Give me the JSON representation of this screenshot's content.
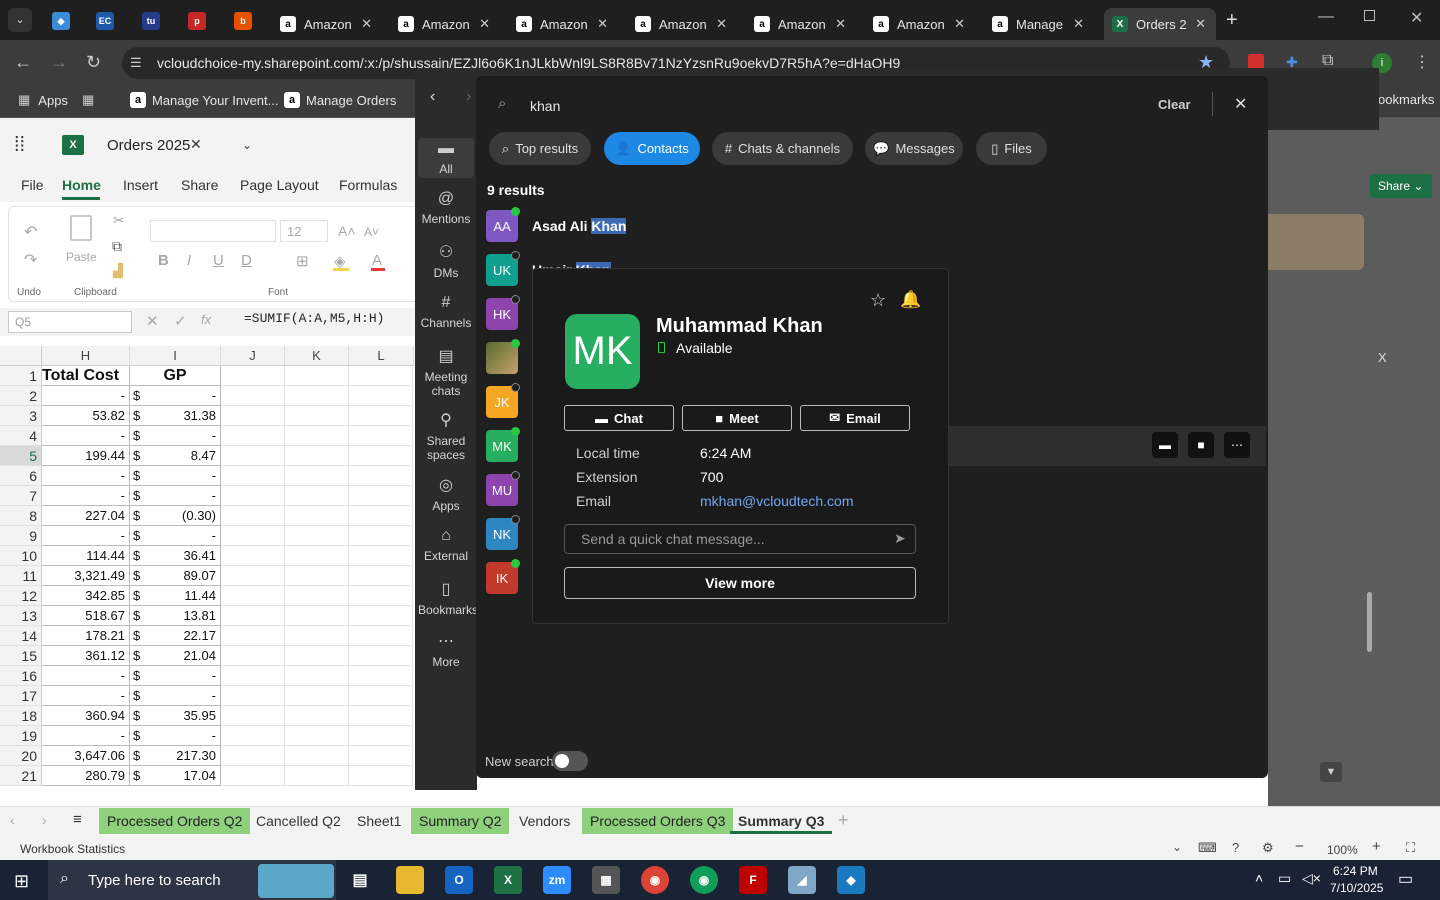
{
  "browser": {
    "tabs": [
      {
        "label": "Amazon",
        "favicon": "amazon-icon"
      },
      {
        "label": "Amazon",
        "favicon": "amazon-icon"
      },
      {
        "label": "Amazon",
        "favicon": "amazon-icon"
      },
      {
        "label": "Amazon",
        "favicon": "amazon-icon"
      },
      {
        "label": "Amazon",
        "favicon": "amazon-icon"
      },
      {
        "label": "Amazon",
        "favicon": "amazon-icon"
      },
      {
        "label": "Manage",
        "favicon": "amazon-icon"
      },
      {
        "label": "Orders 2",
        "favicon": "excel-icon"
      }
    ],
    "pinned": [
      "EC",
      "tu",
      "p",
      "b"
    ],
    "url": "vcloudchoice-my.sharepoint.com/:x:/p/shussain/EZJl6o6K1nJLkbWnl9LS8R8Bv71NzYzsnRu9oekvD7R5hA?e=dHaOH9",
    "bookmarks": {
      "apps": "Apps",
      "b1": "Manage Your Invent...",
      "b2": "Manage Orders",
      "overflow": "ookmarks"
    }
  },
  "excel": {
    "file_name": "Orders 2025",
    "ribbon_tabs": [
      "File",
      "Home",
      "Insert",
      "Share",
      "Page Layout",
      "Formulas"
    ],
    "active_tab": "Home",
    "undo_label": "Undo",
    "clipboard_label": "Clipboard",
    "paste_label": "Paste",
    "font_label": "Font",
    "font_size": "12",
    "share_label": "Share",
    "user_initials": "IK",
    "name_box": "Q5",
    "formula": "=SUMIF(A:A,M5,H:H)",
    "columns": [
      "H",
      "I",
      "J",
      "K",
      "L"
    ],
    "right_col": "X",
    "headers": {
      "H": "Total Cost",
      "I": "GP"
    },
    "rows": [
      {
        "n": "2",
        "h": "-",
        "c": "$",
        "i": "-"
      },
      {
        "n": "3",
        "h": "53.82",
        "c": "$",
        "i": "31.38"
      },
      {
        "n": "4",
        "h": "-",
        "c": "$",
        "i": "-"
      },
      {
        "n": "5",
        "h": "199.44",
        "c": "$",
        "i": "8.47"
      },
      {
        "n": "6",
        "h": "-",
        "c": "$",
        "i": "-"
      },
      {
        "n": "7",
        "h": "-",
        "c": "$",
        "i": "-"
      },
      {
        "n": "8",
        "h": "227.04",
        "c": "$",
        "i": "(0.30)"
      },
      {
        "n": "9",
        "h": "-",
        "c": "$",
        "i": "-"
      },
      {
        "n": "10",
        "h": "114.44",
        "c": "$",
        "i": "36.41"
      },
      {
        "n": "11",
        "h": "3,321.49",
        "c": "$",
        "i": "89.07"
      },
      {
        "n": "12",
        "h": "342.85",
        "c": "$",
        "i": "11.44"
      },
      {
        "n": "13",
        "h": "518.67",
        "c": "$",
        "i": "13.81"
      },
      {
        "n": "14",
        "h": "178.21",
        "c": "$",
        "i": "22.17"
      },
      {
        "n": "15",
        "h": "361.12",
        "c": "$",
        "i": "21.04"
      },
      {
        "n": "16",
        "h": "-",
        "c": "$",
        "i": "-"
      },
      {
        "n": "17",
        "h": "-",
        "c": "$",
        "i": "-"
      },
      {
        "n": "18",
        "h": "360.94",
        "c": "$",
        "i": "35.95"
      },
      {
        "n": "19",
        "h": "-",
        "c": "$",
        "i": "-"
      },
      {
        "n": "20",
        "h": "3,647.06",
        "c": "$",
        "i": "217.30"
      },
      {
        "n": "21",
        "h": "280.79",
        "c": "$",
        "i": "17.04"
      }
    ],
    "sheet_tabs": [
      {
        "label": "Processed Orders Q2",
        "green": true
      },
      {
        "label": "Cancelled Q2",
        "green": false
      },
      {
        "label": "Sheet1",
        "green": false
      },
      {
        "label": "Summary Q2",
        "green": true
      },
      {
        "label": "Vendors",
        "green": false
      },
      {
        "label": "Processed Orders Q3",
        "green": true
      },
      {
        "label": "Summary Q3",
        "green": false,
        "active": true
      }
    ],
    "status_left": "Workbook Statistics",
    "zoom": "100%"
  },
  "teams": {
    "rail": [
      {
        "label": "All",
        "icon": "chat-icon"
      },
      {
        "label": "Mentions",
        "icon": "at-icon"
      },
      {
        "label": "DMs",
        "icon": "people-icon"
      },
      {
        "label": "Channels",
        "icon": "hash-icon"
      },
      {
        "label": "Meeting chats",
        "icon": "calendar-icon"
      },
      {
        "label": "Shared spaces",
        "icon": "share-icon"
      },
      {
        "label": "Apps",
        "icon": "apps-icon"
      },
      {
        "label": "External",
        "icon": "external-icon"
      },
      {
        "label": "Bookmarks",
        "icon": "bookmark-icon"
      },
      {
        "label": "More",
        "icon": "more-icon"
      }
    ],
    "search_value": "khan",
    "clear_label": "Clear",
    "filters": [
      "Top results",
      "Contacts",
      "Chats & channels",
      "Messages",
      "Files"
    ],
    "active_filter": "Contacts",
    "results_count": "9 results",
    "results": [
      {
        "initials": "AA",
        "color": "#7e57c2",
        "first": "Asad Ali ",
        "hl": "Khan",
        "online": true
      },
      {
        "initials": "UK",
        "color": "#0e9f8e",
        "first": "Umair ",
        "hl": "Khan",
        "online": false
      },
      {
        "initials": "HK",
        "color": "#8e44ad",
        "online": false
      },
      {
        "initials": "",
        "color": "#6d8a3a",
        "online": true,
        "photo": true
      },
      {
        "initials": "JK",
        "color": "#f5a623",
        "online": false
      },
      {
        "initials": "MK",
        "color": "#27ae60",
        "online": true
      },
      {
        "initials": "MU",
        "color": "#8e44ad",
        "online": false
      },
      {
        "initials": "NK",
        "color": "#2e86c1",
        "online": false
      },
      {
        "initials": "IK",
        "color": "#c0392b",
        "online": true
      }
    ],
    "new_search_label": "New search",
    "card": {
      "initials": "MK",
      "name": "Muhammad Khan",
      "status": "Available",
      "chat_label": "Chat",
      "meet_label": "Meet",
      "email_label": "Email",
      "local_time_label": "Local time",
      "local_time": "6:24 AM",
      "extension_label": "Extension",
      "extension": "700",
      "email_field_label": "Email",
      "email": "mkhan@vcloudtech.com",
      "quick_chat_placeholder": "Send a quick chat message...",
      "view_more_label": "View more"
    }
  },
  "taskbar": {
    "search_placeholder": "Type here to search",
    "time": "6:24 PM",
    "date": "7/10/2025"
  }
}
